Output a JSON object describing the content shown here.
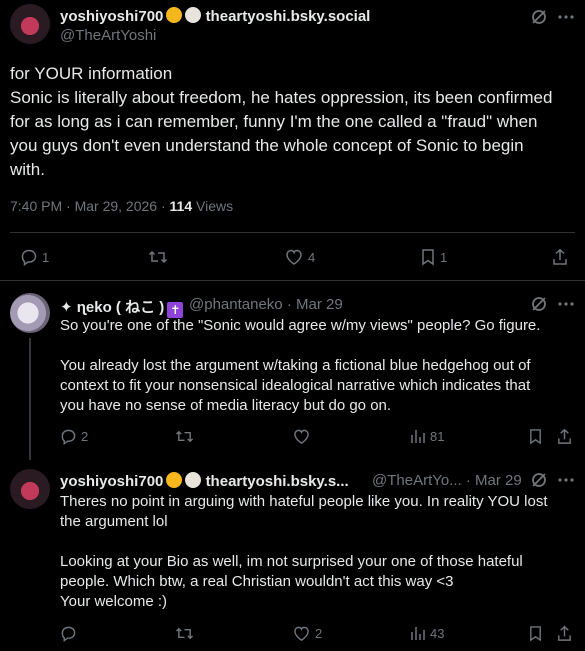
{
  "main_tweet": {
    "display_name": "yoshiyoshi700",
    "name_suffix": "theartyoshi.bsky.social",
    "handle": "@TheArtYoshi",
    "lines": [
      "for YOUR information",
      "Sonic is literally about freedom, he hates oppression, its been confirmed",
      "for as long as i can remember, funny I'm the one called a \"fraud\" when",
      "you guys don't even understand the whole concept of Sonic to begin",
      "with."
    ],
    "timestamp": "7:40 PM · Mar 29, 2026 · ",
    "views_count": "114",
    "views_label": " Views",
    "replies": "1",
    "likes": "4",
    "bookmarks": "1"
  },
  "reply1": {
    "display_name": "✦ ɳeko ( ねこ )",
    "handle": "@phantaneko",
    "date": "· Mar 29",
    "lines": [
      "So you're one of the \"Sonic would agree w/my views\" people? Go figure.",
      "",
      "You already lost the argument w/taking a fictional blue hedgehog out of",
      "context to fit your nonsensical idealogical narrative which indicates that",
      "you have no sense of media literacy but do go on."
    ],
    "replies": "2",
    "views": "81"
  },
  "reply2": {
    "display_name": "yoshiyoshi700",
    "name_suffix": "theartyoshi.bsky.s...",
    "handle": "@TheArtYo...",
    "date": "· Mar 29",
    "lines": [
      "Theres no point in arguing with hateful people like you. In reality YOU lost",
      "the argument lol",
      "",
      "Looking at your Bio as well, im not surprised your one of those hateful",
      "people. Which btw, a real Christian wouldn't act this way <3",
      "Your welcome :)"
    ],
    "likes": "2",
    "views": "43"
  },
  "colors": {
    "background": "#000000",
    "text": "#e7e9ea",
    "muted": "#71767b",
    "divider": "#2f3336"
  }
}
